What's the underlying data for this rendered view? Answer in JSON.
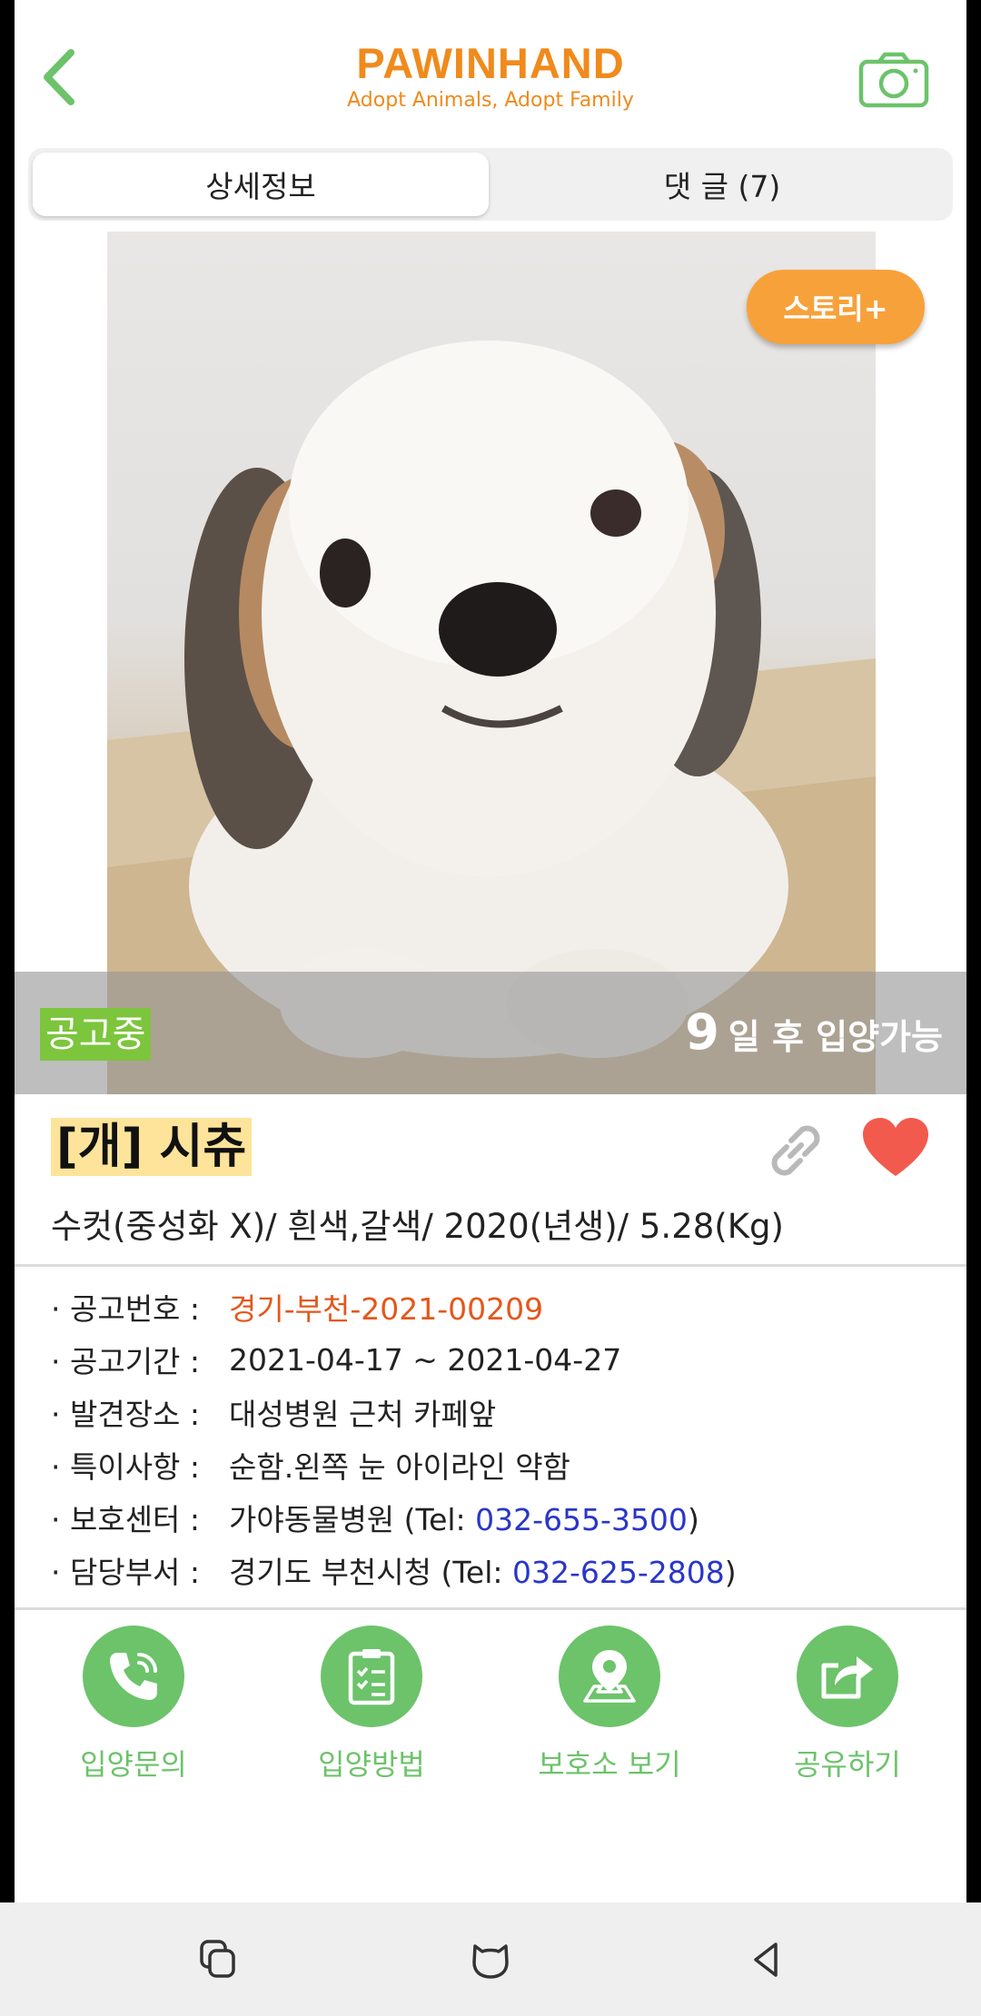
{
  "header": {
    "brand_name": "PAWINHAND",
    "brand_tagline": "Adopt Animals, Adopt Family"
  },
  "tabs": [
    {
      "label": "상세정보",
      "active": true
    },
    {
      "label": "댓 글 (7)",
      "active": false
    }
  ],
  "photo": {
    "story_button": "스토리+",
    "status_badge": "공고중",
    "days_number": "9",
    "days_text": "일 후 입양가능"
  },
  "animal": {
    "title": "[개] 시츄",
    "description": "수컷(중성화 X)/ 흰색,갈색/ 2020(년생)/ 5.28(Kg)",
    "favorited": true
  },
  "details": [
    {
      "label": "· 공고번호 :",
      "value": "경기-부천-2021-00209",
      "style": "orange"
    },
    {
      "label": "· 공고기간 :",
      "value": "2021-04-17 ~ 2021-04-27"
    },
    {
      "label": "· 발견장소 :",
      "value": "대성병원 근처 카페앞"
    },
    {
      "label": "· 특이사항 :",
      "value": "순함.왼쪽 눈 아이라인 약함"
    },
    {
      "label": "· 보호센터 :",
      "value_prefix": "가야동물병원 (Tel: ",
      "phone": "032-655-3500",
      "value_suffix": ")"
    },
    {
      "label": "· 담당부서 :",
      "value_prefix": "경기도 부천시청 (Tel: ",
      "phone": "032-625-2808",
      "value_suffix": ")"
    }
  ],
  "actions": [
    {
      "label": "입양문의",
      "icon": "phone-icon"
    },
    {
      "label": "입양방법",
      "icon": "clipboard-icon"
    },
    {
      "label": "보호소 보기",
      "icon": "map-pin-icon"
    },
    {
      "label": "공유하기",
      "icon": "share-icon"
    }
  ],
  "colors": {
    "brand_orange": "#f08a1c",
    "action_green": "#6cc36a",
    "status_green": "#7cc53c",
    "heart_red": "#f25a4e",
    "link_blue": "#2a36c9"
  }
}
